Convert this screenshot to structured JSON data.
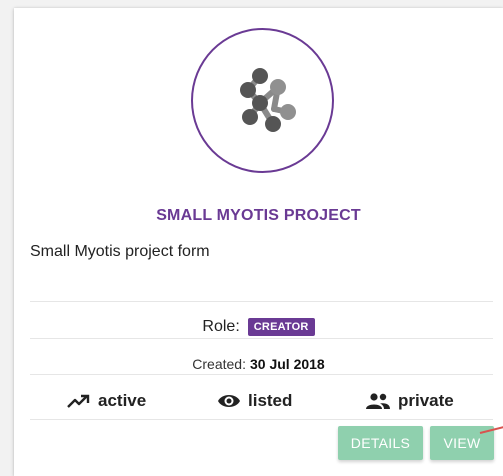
{
  "project": {
    "title": "SMALL MYOTIS PROJECT",
    "description": "Small Myotis project form",
    "role_label": "Role:",
    "role": "CREATOR",
    "created_label": "Created:",
    "created_date": "30 Jul 2018",
    "logo_icon": "molecule-icon"
  },
  "status": {
    "active": {
      "icon": "trending-up-icon",
      "label": "active"
    },
    "listed": {
      "icon": "eye-icon",
      "label": "listed"
    },
    "private": {
      "icon": "people-icon",
      "label": "private"
    }
  },
  "buttons": {
    "details": "DETAILS",
    "view": "VIEW"
  },
  "colors": {
    "accent": "#6a3a94",
    "button": "#8fd0ae",
    "annotation": "#d9534f"
  }
}
